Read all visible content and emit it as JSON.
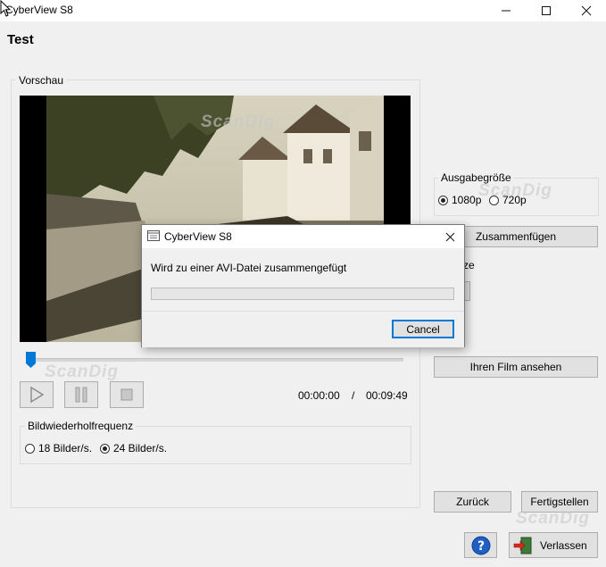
{
  "window": {
    "title": "CyberView S8",
    "page_title": "Test"
  },
  "preview": {
    "group_label": "Vorschau",
    "playback_progress": 0.0,
    "current_time": "00:00:00",
    "time_separator": "/",
    "total_time": "00:09:49"
  },
  "framerate": {
    "group_label": "Bildwiederholfrequenz",
    "options": [
      "18 Bilder/s.",
      "24 Bilder/s."
    ],
    "selected": "24 Bilder/s."
  },
  "output_size": {
    "group_label": "Ausgabegröße",
    "options": [
      "1080p",
      "720p"
    ],
    "selected": "1080p"
  },
  "right_panel": {
    "merge_button": "Zusammenfügen",
    "partial_label": "ze",
    "watch_button": "Ihren Film ansehen",
    "back_button": "Zurück",
    "finish_button": "Fertigstellen",
    "exit_button": "Verlassen",
    "help_icon": "question-icon",
    "exit_icon": "exit-door-icon"
  },
  "watermarks": [
    "ScanDig",
    "ScanDig",
    "ScanDig",
    "ScanDig"
  ],
  "dialog": {
    "title": "CyberView S8",
    "message": "Wird zu einer AVI-Datei zusammengefügt",
    "progress": 0.0,
    "cancel_button": "Cancel"
  },
  "colors": {
    "accent_blue": "#0078d7",
    "progress_green": "#06b025"
  }
}
